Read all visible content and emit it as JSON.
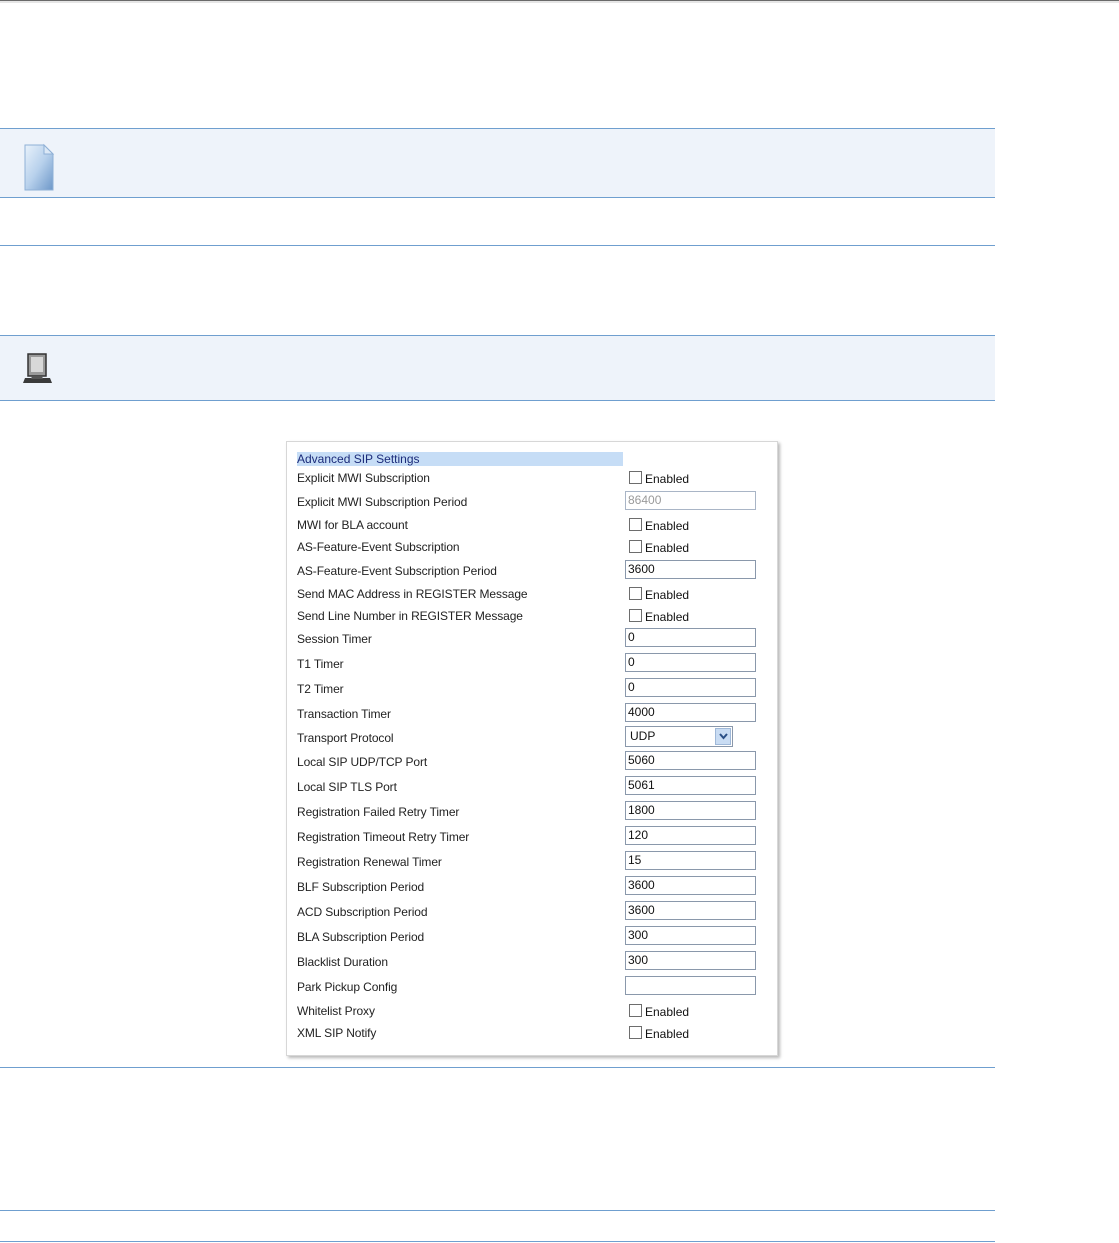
{
  "notes": {
    "note_icon": "note-page-icon",
    "web_ui_icon": "web-ui-monitor-icon"
  },
  "panel": {
    "header": "Advanced SIP Settings",
    "checkbox_label": "Enabled",
    "rows": [
      {
        "label": "Explicit MWI Subscription",
        "type": "checkbox",
        "checked": false
      },
      {
        "label": "Explicit MWI Subscription Period",
        "type": "text",
        "value": "86400",
        "disabled": true
      },
      {
        "label": "MWI for BLA account",
        "type": "checkbox",
        "checked": false
      },
      {
        "label": "AS-Feature-Event Subscription",
        "type": "checkbox",
        "checked": false
      },
      {
        "label": "AS-Feature-Event Subscription Period",
        "type": "text",
        "value": "3600"
      },
      {
        "label": "Send MAC Address in REGISTER Message",
        "type": "checkbox",
        "checked": false
      },
      {
        "label": "Send Line Number in REGISTER Message",
        "type": "checkbox",
        "checked": false
      },
      {
        "label": "Session Timer",
        "type": "text",
        "value": "0"
      },
      {
        "label": "T1 Timer",
        "type": "text",
        "value": "0"
      },
      {
        "label": "T2 Timer",
        "type": "text",
        "value": "0"
      },
      {
        "label": "Transaction Timer",
        "type": "text",
        "value": "4000"
      },
      {
        "label": "Transport Protocol",
        "type": "select",
        "value": "UDP"
      },
      {
        "label": "Local SIP UDP/TCP Port",
        "type": "text",
        "value": "5060"
      },
      {
        "label": "Local SIP TLS Port",
        "type": "text",
        "value": "5061"
      },
      {
        "label": "Registration Failed Retry Timer",
        "type": "text",
        "value": "1800"
      },
      {
        "label": "Registration Timeout Retry Timer",
        "type": "text",
        "value": "120"
      },
      {
        "label": "Registration Renewal Timer",
        "type": "text",
        "value": "15"
      },
      {
        "label": "BLF Subscription Period",
        "type": "text",
        "value": "3600"
      },
      {
        "label": "ACD Subscription Period",
        "type": "text",
        "value": "3600"
      },
      {
        "label": "BLA Subscription Period",
        "type": "text",
        "value": "300"
      },
      {
        "label": "Blacklist Duration",
        "type": "text",
        "value": "300"
      },
      {
        "label": "Park Pickup Config",
        "type": "text",
        "value": ""
      },
      {
        "label": "Whitelist Proxy",
        "type": "checkbox",
        "checked": false
      },
      {
        "label": "XML SIP Notify",
        "type": "checkbox",
        "checked": false
      }
    ]
  }
}
